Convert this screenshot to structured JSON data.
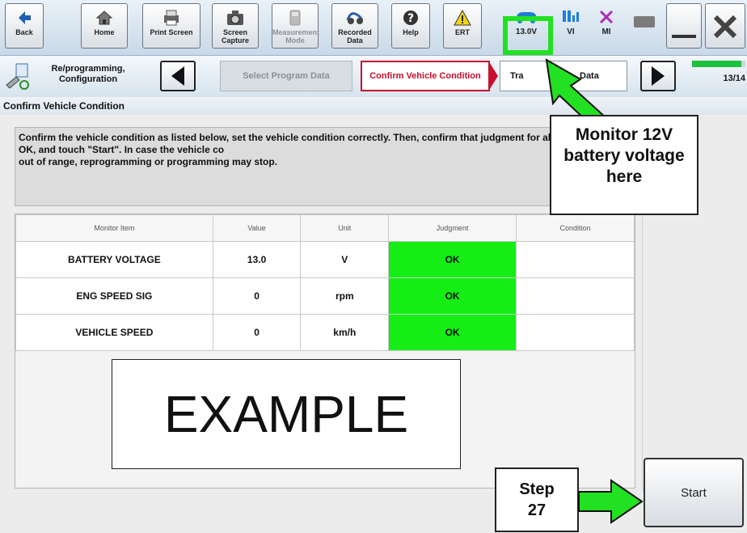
{
  "toolbar": {
    "buttons": [
      {
        "label": "Back",
        "icon": "back-arrow-icon"
      },
      {
        "label": "Home",
        "icon": "home-icon"
      },
      {
        "label": "Print Screen",
        "icon": "printer-icon"
      },
      {
        "label": "Screen Capture",
        "icon": "camera-icon"
      },
      {
        "label": "Measurement Mode",
        "icon": "meter-icon"
      },
      {
        "label": "Recorded Data",
        "icon": "recorded-data-icon"
      },
      {
        "label": "Help",
        "icon": "help-icon"
      },
      {
        "label": "ERT",
        "icon": "warning-icon"
      }
    ],
    "battery_voltage": "13.0V",
    "vi_label": "VI",
    "mi_label": "MI"
  },
  "nav": {
    "section_label": "Re/programming, Configuration",
    "steps": [
      "Select Program Data",
      "Confirm Vehicle Condition",
      "Transfer Data"
    ],
    "visible_step3": "Tra",
    "visible_step3_tail": "Data",
    "progress": "13/14",
    "progress_fraction": 0.93
  },
  "page": {
    "title": "Confirm Vehicle Condition",
    "instruction": "Confirm the vehicle condition as listed below, set the vehicle condition correctly. Then, confirm that judgment for all items indicate OK, and touch \"Start\". In case the vehicle co",
    "instruction_tail": "out of range, reprogramming or programming may stop."
  },
  "table": {
    "headers": [
      "Monitor Item",
      "Value",
      "Unit",
      "Judgment",
      "Condition"
    ],
    "rows": [
      {
        "item": "BATTERY VOLTAGE",
        "value": "13.0",
        "unit": "V",
        "judgment": "OK",
        "condition": ""
      },
      {
        "item": "ENG SPEED SIG",
        "value": "0",
        "unit": "rpm",
        "judgment": "OK",
        "condition": ""
      },
      {
        "item": "VEHICLE SPEED",
        "value": "0",
        "unit": "km/h",
        "judgment": "OK",
        "condition": ""
      }
    ]
  },
  "overlay": {
    "example": "EXAMPLE",
    "monitor_note": "Monitor 12V battery voltage here",
    "step_word": "Step",
    "step_number": "27"
  },
  "start_label": "Start",
  "colors": {
    "ok": "#15ee15",
    "callout_arrow": "#22e122",
    "highlight_box": "#22e122",
    "nav_active": "#c8102e"
  }
}
